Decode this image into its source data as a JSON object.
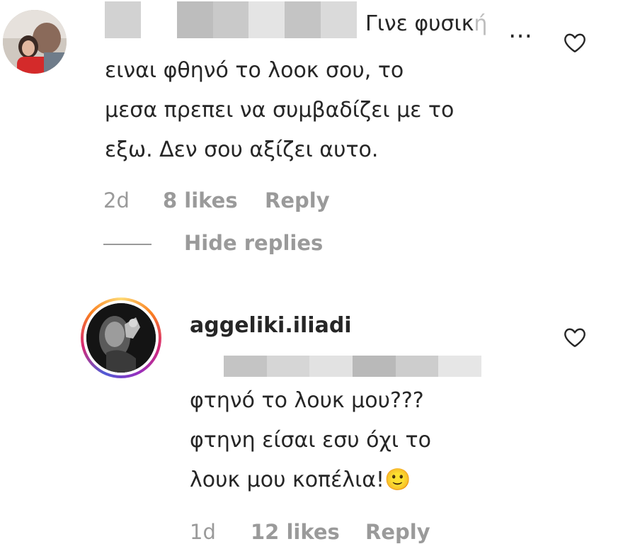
{
  "parent_comment": {
    "lead_text": "Γινε φυσικ",
    "lead_fade": "ή",
    "ellipsis": "…",
    "lines": [
      "ειναι φθηνό το λοοκ σου, το",
      "μεσα πρεπει να συμβαδίζει με το",
      "εξω. Δεν σου αξίζει αυτο."
    ],
    "time": "2d",
    "likes": "8 likes",
    "reply_label": "Reply",
    "hide_replies_label": "Hide replies"
  },
  "reply_comment": {
    "username": "aggeliki.iliadi",
    "lines": [
      "φτηνό το λουκ μου???",
      "φτηνη είσαι εσυ όχι το",
      "λουκ μου κοπέλια!🙂"
    ],
    "time": "1d",
    "likes": "12 likes",
    "reply_label": "Reply"
  },
  "icons": {
    "like": "heart-outline-icon",
    "ellipsis": "more-text-icon"
  },
  "colors": {
    "text": "#262626",
    "secondary": "#9a9a9a",
    "story_ring": [
      "#feda75",
      "#fa7e1e",
      "#d62976",
      "#962fbf",
      "#4f5bd5"
    ]
  }
}
